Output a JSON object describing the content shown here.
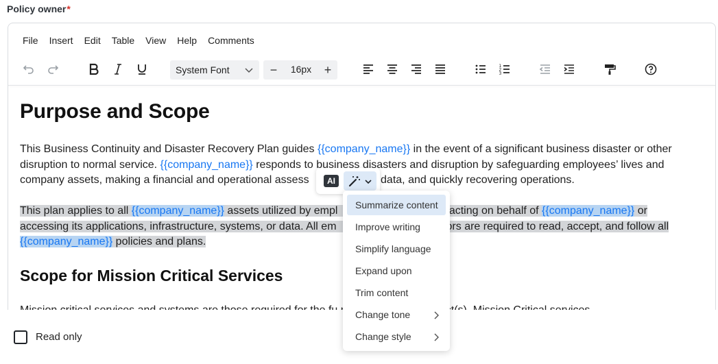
{
  "field": {
    "label": "Policy owner",
    "required_mark": "*"
  },
  "menubar": [
    "File",
    "Insert",
    "Edit",
    "Table",
    "View",
    "Help",
    "Comments"
  ],
  "toolbar": {
    "font_family": "System Font",
    "font_size": "16px",
    "minus": "−",
    "plus": "+"
  },
  "document": {
    "heading": "Purpose and Scope",
    "p1": [
      "This Business Continuity and Disaster Recovery Plan guides ",
      "{{company_name}}",
      " in the event of a significant business disaster or other disruption to normal service. ",
      "{{company_name}}",
      " responds to business disasters and disruption by safeguarding employees’ lives and company assets, making a financial and operational assess",
      "data, and quickly recovering operations."
    ],
    "p2": [
      "This plan applies to all ",
      "{{company_name}}",
      " assets utilized by empl",
      "s acting on behalf of ",
      "{{company_name}}",
      " or",
      "accessing its applications, infrastructure, systems, or data. All em",
      "ors are required to read, accept, and follow all",
      "{{company_name}}",
      " policies and plans."
    ],
    "heading2": "Scope for Mission Critical Services",
    "p3": "Mission critical services and systems are those required for the fu                                             mpany_name}} product(s). Mission Critical services"
  },
  "footer": {
    "read_only_label": "Read only"
  },
  "ai": {
    "badge": "AI",
    "menu": [
      {
        "label": "Summarize content",
        "submenu": false
      },
      {
        "label": "Improve writing",
        "submenu": false
      },
      {
        "label": "Simplify language",
        "submenu": false
      },
      {
        "label": "Expand upon",
        "submenu": false
      },
      {
        "label": "Trim content",
        "submenu": false
      },
      {
        "label": "Change tone",
        "submenu": true
      },
      {
        "label": "Change style",
        "submenu": true
      }
    ]
  },
  "colors": {
    "variable": "#1877f2",
    "selection": "#d3d5d8",
    "accent_bg": "#dde9f7",
    "required": "#d6312a"
  }
}
